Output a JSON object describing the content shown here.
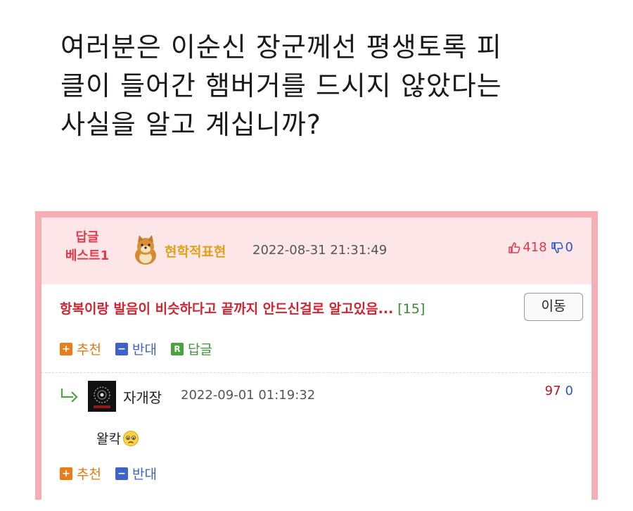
{
  "headline": {
    "line1": "여러분은 이순신 장군께선 평생토록 피",
    "line2": "클이 들어간 햄버거를 드시지 않았다는",
    "line3": "사실을 알고 계십니까?"
  },
  "best_comment": {
    "badge_line1": "답글",
    "badge_line2": "베스트1",
    "author": "현학적표현",
    "datetime": "2022-08-31 21:31:49",
    "upvotes": "418",
    "downvotes": "0",
    "text": "항복이랑 발음이 비슷하다고 끝까지 안드신걸로 알고있음...",
    "reply_count": "[15]",
    "move_label": "이동",
    "actions": {
      "recommend": "추천",
      "oppose": "반대",
      "reply": "답글"
    },
    "icons": {
      "recommend": "+",
      "oppose": "−",
      "reply": "R"
    }
  },
  "reply": {
    "author": "자개장",
    "datetime": "2022-09-01 01:19:32",
    "upvotes": "97",
    "downvotes": "0",
    "text": "왈칵",
    "actions": {
      "recommend": "추천",
      "oppose": "반대"
    },
    "icons": {
      "recommend": "+",
      "oppose": "−"
    }
  },
  "colors": {
    "card_border": "#f4aeb4",
    "best_bg": "#fde6e8",
    "best_red": "#e23a4a",
    "nick_gold": "#e0a21a",
    "recommend_orange": "#ea7d1a",
    "oppose_blue": "#3f62c7",
    "reply_green": "#49a33e"
  }
}
